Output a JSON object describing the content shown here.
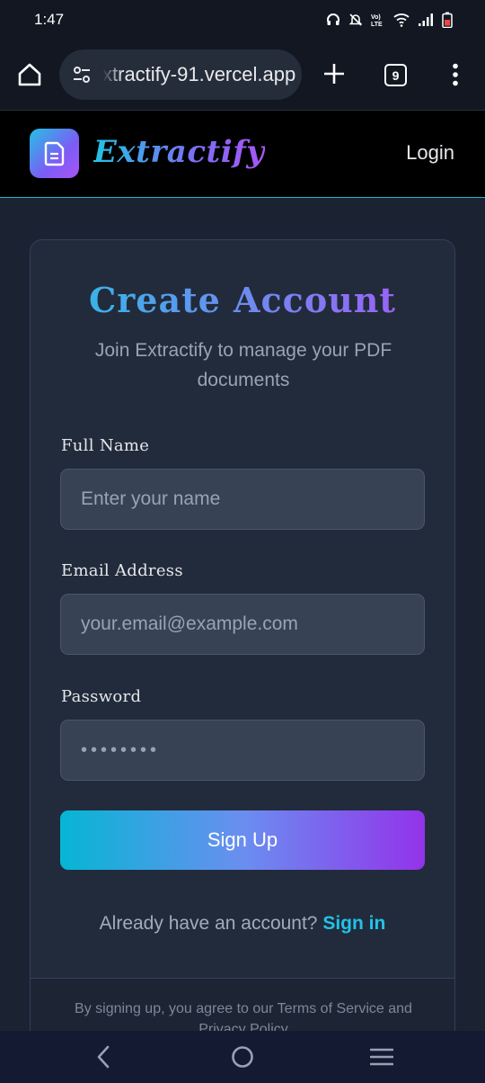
{
  "status_bar": {
    "time": "1:47",
    "icons": [
      "headphones-icon",
      "bell-off-icon",
      "volte-icon",
      "wifi-icon",
      "signal-icon",
      "battery-icon"
    ]
  },
  "browser": {
    "url": "xtractify-91.vercel.app",
    "tab_count": "9"
  },
  "header": {
    "brand": "Extractify",
    "login_label": "Login"
  },
  "signup": {
    "title": "Create Account",
    "subtitle": "Join Extractify to manage your PDF documents",
    "fields": {
      "name": {
        "label": "Full Name",
        "placeholder": "Enter your name"
      },
      "email": {
        "label": "Email Address",
        "placeholder": "your.email@example.com"
      },
      "password": {
        "label": "Password",
        "value": "••••••••"
      }
    },
    "submit_label": "Sign Up",
    "signin_prompt": "Already have an account?",
    "signin_link": "Sign in",
    "terms": "By signing up, you agree to our Terms of Service and Privacy Policy"
  },
  "colors": {
    "accent_cyan": "#22c3e6",
    "accent_purple": "#a855f7",
    "card_bg": "#222b3b",
    "page_bg": "#1b2333"
  }
}
